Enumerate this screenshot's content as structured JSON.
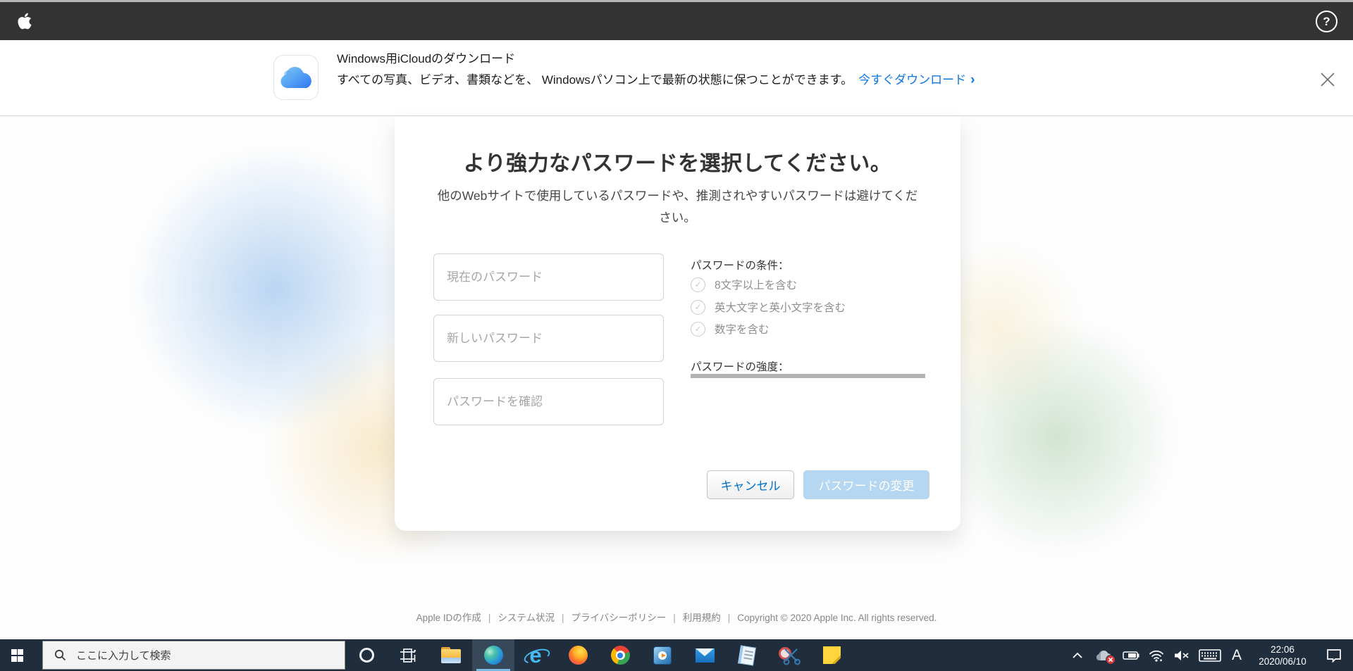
{
  "colors": {
    "topbar_bg": "#333333",
    "link_blue": "#0b78e3",
    "cancel_text_blue": "#0070c9",
    "submit_disabled_bg": "#b5d7f1",
    "taskbar_bg": "#1f2d3d",
    "edge_active_underline": "#7cb9e2",
    "strength_bar_gray": "#b3b3b3"
  },
  "topbar": {
    "help_glyph": "?"
  },
  "banner": {
    "title": "Windows用iCloudのダウンロード",
    "description": "すべての写真、ビデオ、書類などを、 Windowsパソコン上で最新の状態に保つことができます。",
    "link_label": "今すぐダウンロード",
    "link_chevron": "›"
  },
  "dialog": {
    "title": "より強力なパスワードを選択してください。",
    "subtitle": "他のWebサイトで使用しているパスワードや、推測されやすいパスワードは避けてください。",
    "fields": [
      {
        "placeholder": "現在のパスワード"
      },
      {
        "placeholder": "新しいパスワード"
      },
      {
        "placeholder": "パスワードを確認"
      }
    ],
    "requirements": {
      "title": "パスワードの条件：",
      "check_glyph": "✓",
      "items": [
        "8文字以上を含む",
        "英大文字と英小文字を含む",
        "数字を含む"
      ]
    },
    "strength_label": "パスワードの強度：",
    "cancel_label": "キャンセル",
    "submit_label": "パスワードの変更"
  },
  "footer": {
    "links": [
      "Apple IDの作成",
      "システム状況",
      "プライバシーポリシー",
      "利用規約"
    ],
    "separator": "|",
    "copyright": "Copyright © 2020 Apple Inc. All rights reserved."
  },
  "taskbar": {
    "search_placeholder": "ここに入力して検索",
    "app_icons": [
      "cortana",
      "task-view",
      "file-explorer",
      "edge (active)",
      "internet-explorer",
      "firefox",
      "chrome",
      "media-player",
      "mail",
      "notepad",
      "snipping-tool",
      "sticky-notes"
    ],
    "ie_glyph": "e",
    "tray": {
      "ime_mode": "A",
      "time": "22:06",
      "date": "2020/06/10"
    }
  }
}
